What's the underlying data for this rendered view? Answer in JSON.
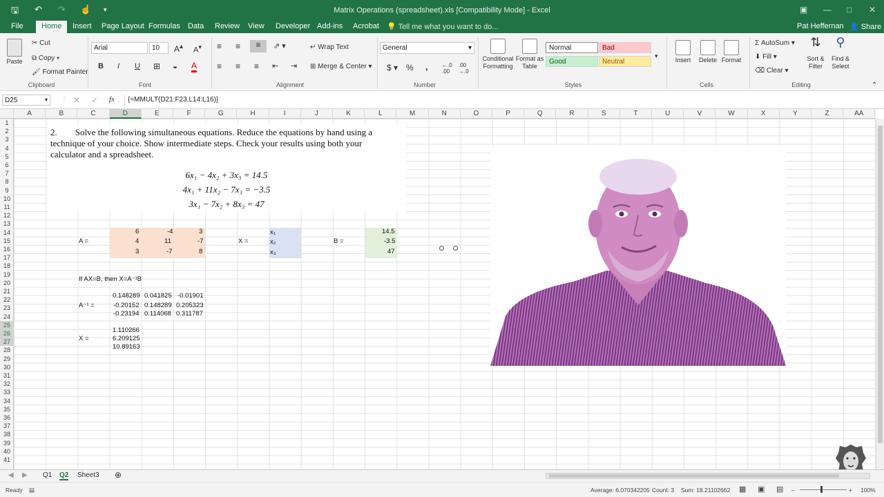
{
  "window": {
    "title": "Matrix Operations (spreadsheet).xls  [Compatibility Mode] - Excel"
  },
  "ribbon_tabs": [
    "File",
    "Home",
    "Insert",
    "Page Layout",
    "Formulas",
    "Data",
    "Review",
    "View",
    "Developer",
    "Add-ins",
    "Acrobat"
  ],
  "tell_me": "Tell me what you want to do...",
  "user": "Pat Heffernan",
  "share": "Share",
  "clipboard": {
    "paste": "Paste",
    "cut": "Cut",
    "copy": "Copy",
    "format_painter": "Format Painter",
    "label": "Clipboard"
  },
  "font": {
    "name": "Arial",
    "size": "10",
    "label": "Font",
    "bold": "B",
    "italic": "I",
    "underline": "U"
  },
  "alignment": {
    "wrap": "Wrap Text",
    "merge": "Merge & Center",
    "label": "Alignment"
  },
  "number": {
    "format": "General",
    "label": "Number",
    "currency": "$",
    "percent": "%",
    "comma": ","
  },
  "styles": {
    "conditional": "Conditional Formatting",
    "format_table": "Format as Table",
    "normal": "Normal",
    "bad": "Bad",
    "good": "Good",
    "neutral": "Neutral",
    "label": "Styles"
  },
  "cells": {
    "insert": "Insert",
    "delete": "Delete",
    "format": "Format",
    "label": "Cells"
  },
  "editing": {
    "autosum": "AutoSum",
    "fill": "Fill",
    "clear": "Clear",
    "sort": "Sort & Filter",
    "find": "Find & Select",
    "label": "Editing"
  },
  "formula_bar": {
    "name_box": "D25",
    "formula": "{=MMULT(D21:F23,L14:L16)}",
    "fx": "fx"
  },
  "columns": [
    "A",
    "B",
    "C",
    "D",
    "E",
    "F",
    "G",
    "H",
    "I",
    "J",
    "K",
    "L",
    "M",
    "N",
    "O",
    "P",
    "Q",
    "R",
    "S",
    "T",
    "U",
    "V",
    "W",
    "X",
    "Y",
    "Z",
    "AA"
  ],
  "problem": {
    "number": "2.",
    "text": "Solve the following simultaneous equations.  Reduce the equations by hand using a technique of your choice.  Show intermediate steps.  Check your results using both your calculator and a spreadsheet.",
    "eq1": "6x₁ − 4x₂ + 3x₃ = 14.5",
    "eq2": "4x₁ + 11x₂ − 7x₃ = −3.5",
    "eq3": "3x₁ − 7x₂ + 8x₃ = 47"
  },
  "sheet": {
    "a_label": "A =",
    "a_matrix": [
      [
        "6",
        "-4",
        "3"
      ],
      [
        "4",
        "11",
        "-7"
      ],
      [
        "3",
        "-7",
        "8"
      ]
    ],
    "x_label": "X =",
    "x_vars": [
      "x₁",
      "x₂",
      "x₃"
    ],
    "b_label": "B =",
    "b_vector": [
      "14.5",
      "-3.5",
      "47"
    ],
    "note": "If AX=B, then X=A⁻¹B",
    "ainv_label": "A⁻¹ =",
    "ainv": [
      [
        "0.148289",
        "0.041825",
        "-0.01901"
      ],
      [
        "-0.20152",
        "0.148289",
        "0.205323"
      ],
      [
        "-0.23194",
        "0.114068",
        "0.311787"
      ]
    ],
    "x_result_label": "X =",
    "x_result": [
      "1.110266",
      "6.209125",
      "10.89163"
    ]
  },
  "sheet_tabs": [
    "Q1",
    "Q2",
    "Sheet3"
  ],
  "active_sheet": "Q2",
  "status": {
    "ready": "Ready",
    "average": "Average: 6.070342205",
    "count": "Count: 3",
    "sum": "Sum: 18.21102662",
    "zoom": "100%"
  },
  "colors": {
    "excel_green": "#217346",
    "matrix_a_fill": "#fbe0d0",
    "x_fill": "#d9e1f2",
    "b_fill": "#e2efda"
  }
}
